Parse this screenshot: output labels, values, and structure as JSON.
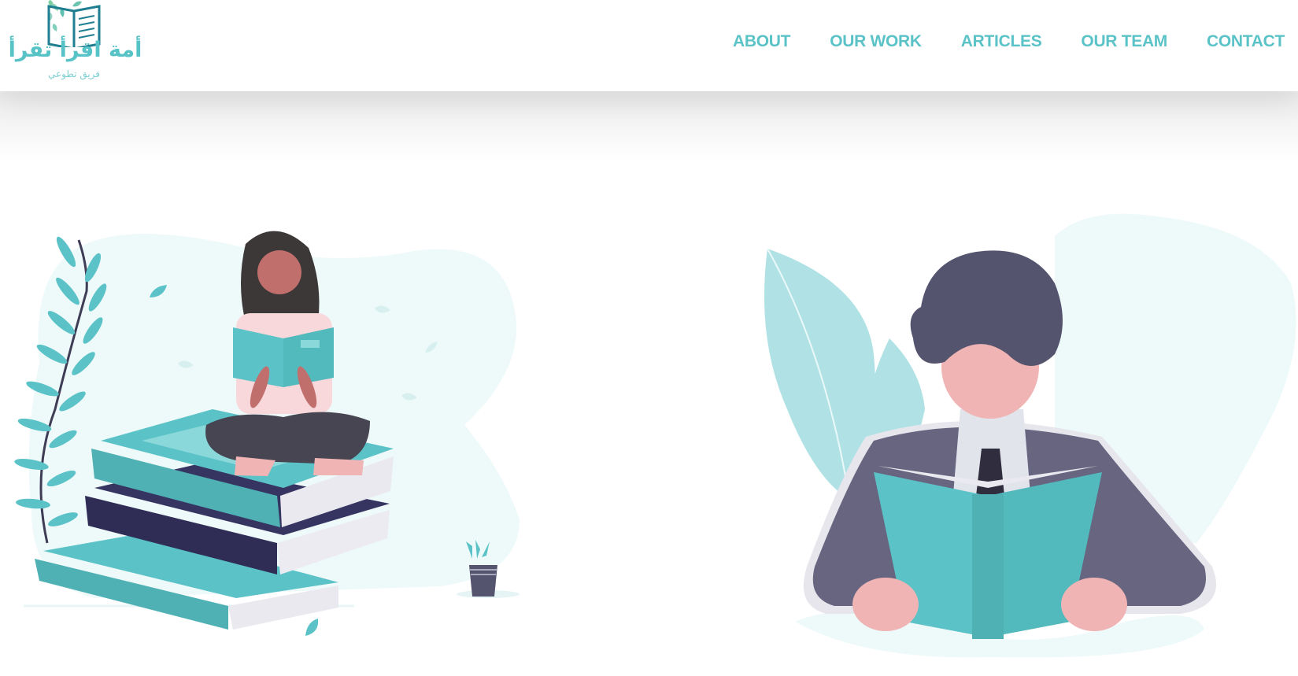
{
  "brand": {
    "title": "أمة اقرأ تقرأ",
    "subtitle": "فريق تطوعي",
    "icon": "book-leaves-icon"
  },
  "nav": {
    "items": [
      {
        "label": "ABOUT"
      },
      {
        "label": "OUR WORK"
      },
      {
        "label": "ARTICLES"
      },
      {
        "label": "OUR TEAM"
      },
      {
        "label": "CONTACT"
      }
    ]
  },
  "colors": {
    "accent": "#5bc3c7",
    "navy": "#363461",
    "skin": "#f0b4b4",
    "suit": "#676580"
  },
  "illustrations": {
    "left": "woman-reading-on-books-illustration",
    "right": "man-reading-book-illustration"
  }
}
